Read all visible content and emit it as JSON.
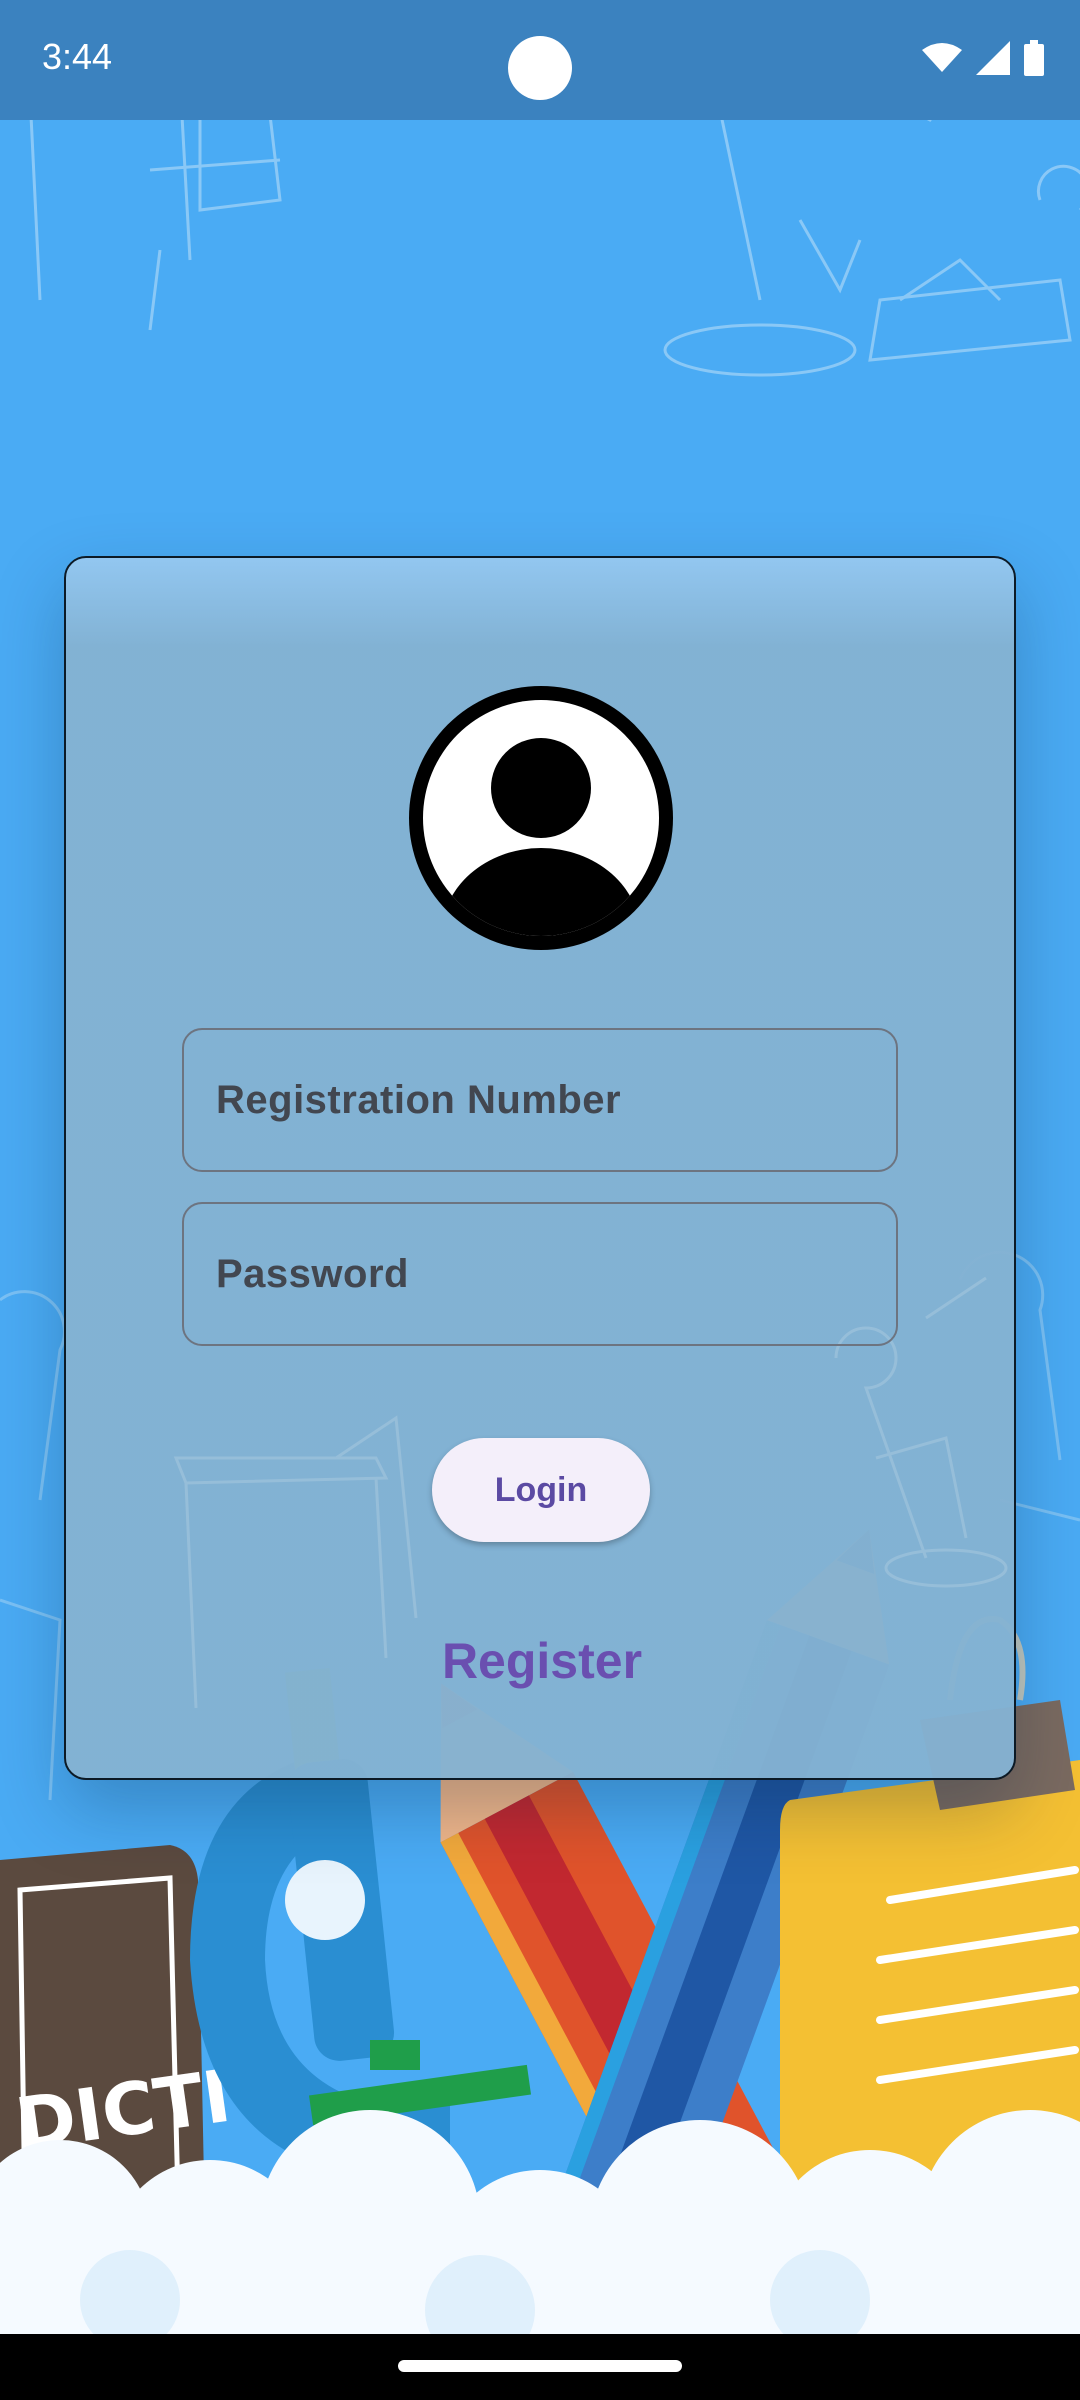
{
  "status_bar": {
    "time": "3:44",
    "icons": [
      "wifi-icon",
      "signal-icon",
      "battery-icon"
    ]
  },
  "login_form": {
    "avatar_icon": "user-avatar-icon",
    "registration_placeholder": "Registration Number",
    "password_placeholder": "Password",
    "login_label": "Login",
    "register_label": "Register"
  },
  "colors": {
    "background": "#4aabf4",
    "status_bar": "#3b82bf",
    "card": "#84b2d2",
    "accent": "#6a4fb0",
    "button_bg": "#f4effa"
  }
}
